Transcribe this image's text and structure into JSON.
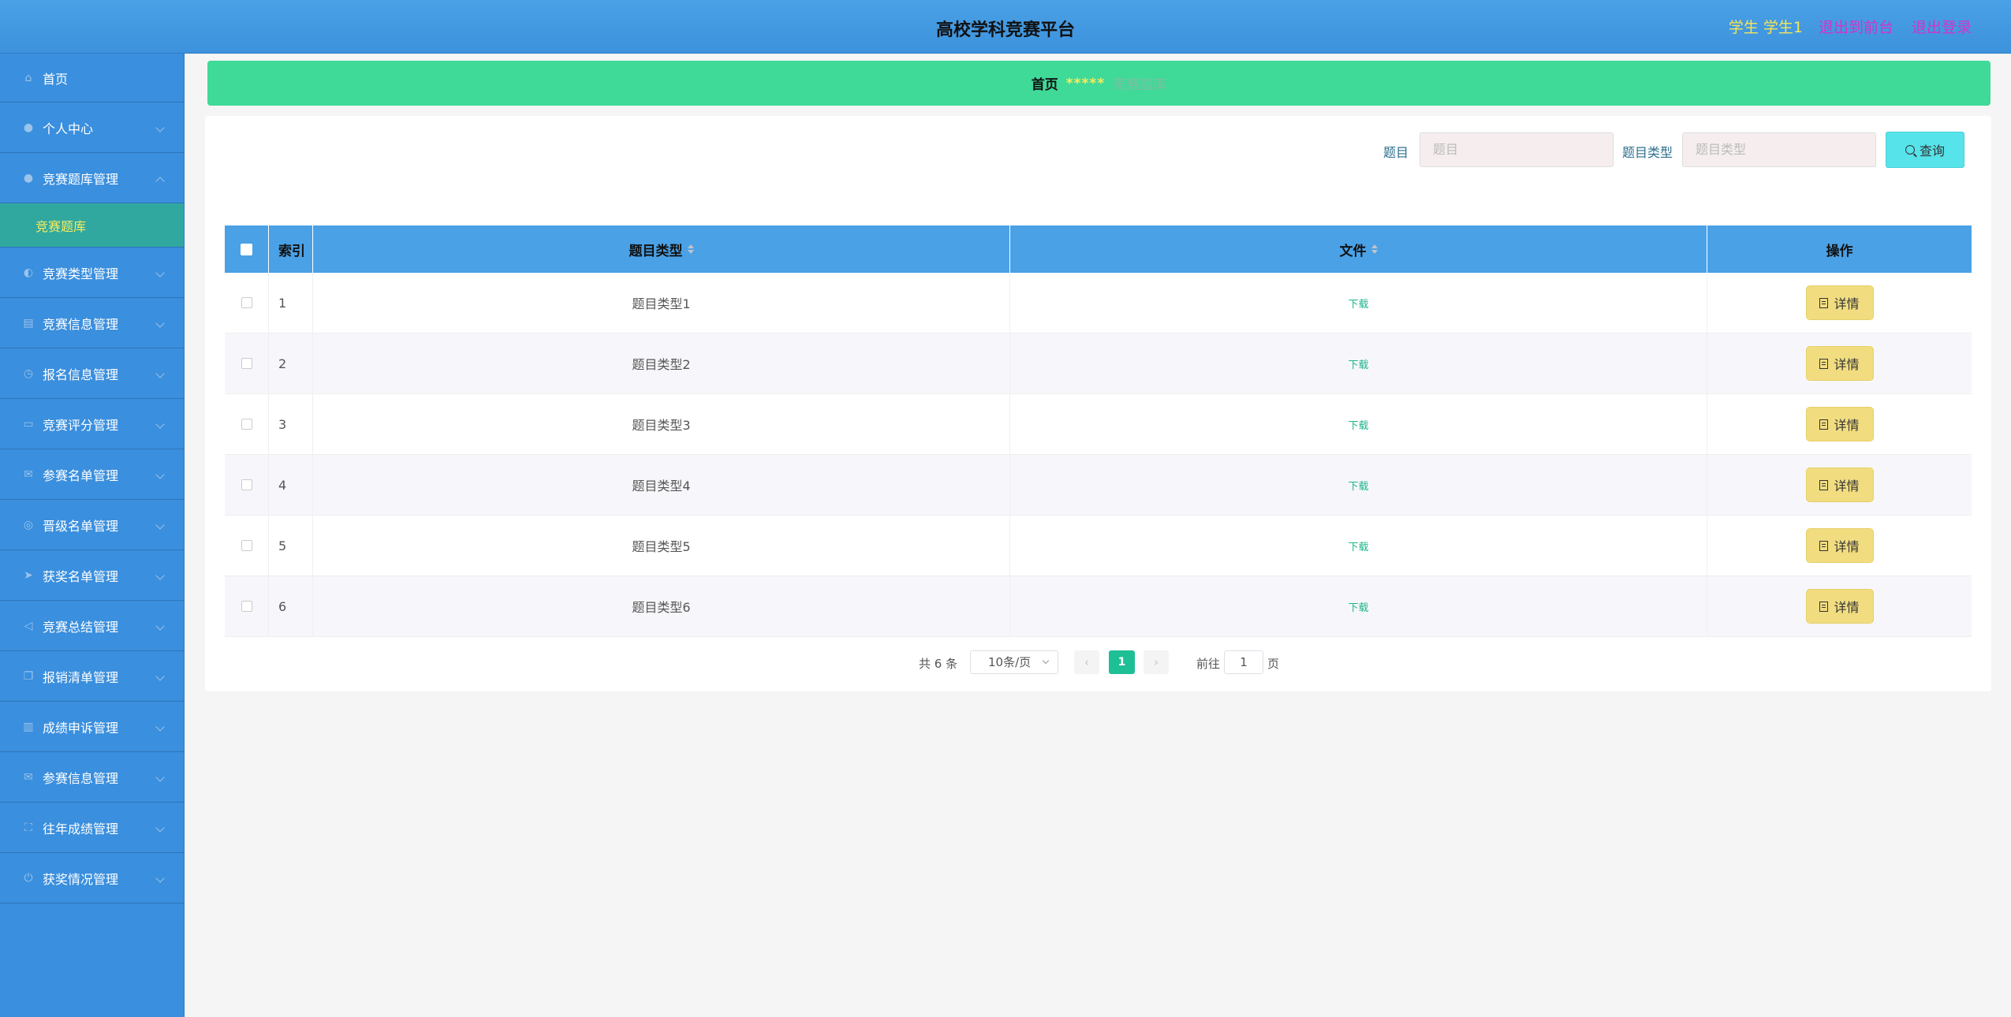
{
  "header": {
    "title": "高校学科竞赛平台",
    "user": "学生 学生1",
    "back_to_front": "退出到前台",
    "logout": "退出登录"
  },
  "sidebar": {
    "items": [
      {
        "label": "首页",
        "icon": "home-icon"
      },
      {
        "label": "个人中心",
        "icon": "user-icon"
      },
      {
        "label": "竞赛题库管理",
        "icon": "user-icon",
        "expanded": true
      },
      {
        "label": "竞赛类型管理",
        "icon": "microphone-icon"
      },
      {
        "label": "竞赛信息管理",
        "icon": "clipboard-icon"
      },
      {
        "label": "报名信息管理",
        "icon": "clock-icon"
      },
      {
        "label": "竞赛评分管理",
        "icon": "monitor-icon"
      },
      {
        "label": "参赛名单管理",
        "icon": "mail-icon"
      },
      {
        "label": "晋级名单管理",
        "icon": "globe-icon"
      },
      {
        "label": "获奖名单管理",
        "icon": "send-icon"
      },
      {
        "label": "竞赛总结管理",
        "icon": "position-icon"
      },
      {
        "label": "报销清单管理",
        "icon": "copy-icon"
      },
      {
        "label": "成绩申诉管理",
        "icon": "chart-icon"
      },
      {
        "label": "参赛信息管理",
        "icon": "message-icon"
      },
      {
        "label": "往年成绩管理",
        "icon": "fullscreen-icon"
      },
      {
        "label": "获奖情况管理",
        "icon": "power-icon"
      }
    ],
    "submenu_label": "竞赛题库"
  },
  "breadcrumb": {
    "home": "首页",
    "separator": "*****",
    "current": "竞赛题库"
  },
  "search": {
    "title_label": "题目",
    "title_placeholder": "题目",
    "type_label": "题目类型",
    "type_placeholder": "题目类型",
    "button": "查询"
  },
  "table": {
    "headers": {
      "index": "索引",
      "type": "题目类型",
      "file": "文件",
      "op": "操作"
    },
    "rows": [
      {
        "index": "1",
        "type": "题目类型1",
        "file": "下载",
        "op": "详情"
      },
      {
        "index": "2",
        "type": "题目类型2",
        "file": "下载",
        "op": "详情"
      },
      {
        "index": "3",
        "type": "题目类型3",
        "file": "下载",
        "op": "详情"
      },
      {
        "index": "4",
        "type": "题目类型4",
        "file": "下载",
        "op": "详情"
      },
      {
        "index": "5",
        "type": "题目类型5",
        "file": "下载",
        "op": "详情"
      },
      {
        "index": "6",
        "type": "题目类型6",
        "file": "下载",
        "op": "详情"
      }
    ]
  },
  "pagination": {
    "total": "共 6 条",
    "page_size": "10条/页",
    "current_page": "1",
    "goto_label": "前往",
    "goto_value": "1",
    "page_suffix": "页"
  },
  "colors": {
    "header": "#4aa1e6",
    "sidebar": "#3a8fde",
    "breadcrumb": "#3fd998",
    "submenu_active": "#30a8a0",
    "detail_button": "#f1dd80",
    "search_button": "#56e3ea",
    "pager_active": "#1ebf94"
  }
}
